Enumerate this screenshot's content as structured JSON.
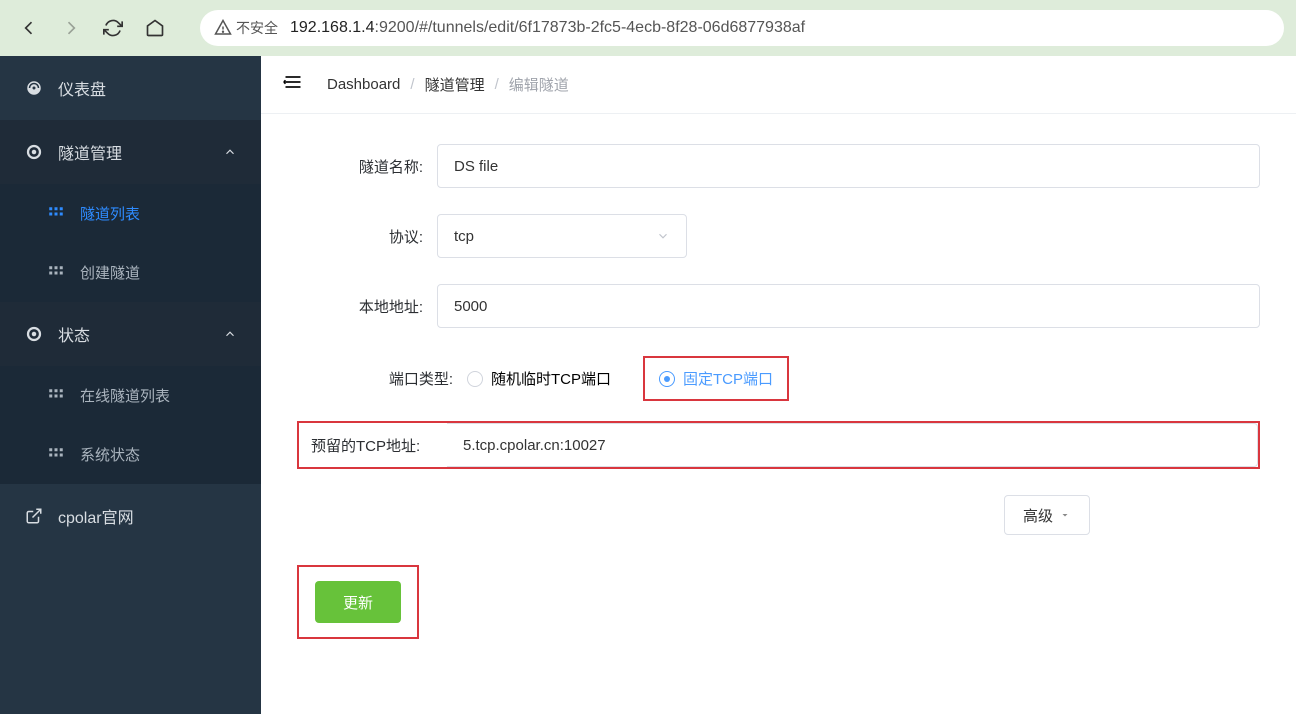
{
  "browser": {
    "insecure_label": "不安全",
    "url_ip": "192.168.1.4",
    "url_rest": ":9200/#/tunnels/edit/6f17873b-2fc5-4ecb-8f28-06d6877938af"
  },
  "sidebar": {
    "dashboard": "仪表盘",
    "tunnel_mgmt": "隧道管理",
    "tunnel_list": "隧道列表",
    "create_tunnel": "创建隧道",
    "status": "状态",
    "online_tunnels": "在线隧道列表",
    "system_status": "系统状态",
    "cpolar_site": "cpolar官网"
  },
  "breadcrumb": {
    "dashboard": "Dashboard",
    "tunnel_mgmt": "隧道管理",
    "edit_tunnel": "编辑隧道"
  },
  "form": {
    "name_label": "隧道名称:",
    "name_value": "DS file",
    "proto_label": "协议:",
    "proto_value": "tcp",
    "local_label": "本地地址:",
    "local_value": "5000",
    "port_type_label": "端口类型:",
    "random_port": "随机临时TCP端口",
    "fixed_port": "固定TCP端口",
    "reserved_tcp_label": "预留的TCP地址:",
    "reserved_tcp_value": "5.tcp.cpolar.cn:10027",
    "advanced": "高级",
    "submit": "更新"
  }
}
